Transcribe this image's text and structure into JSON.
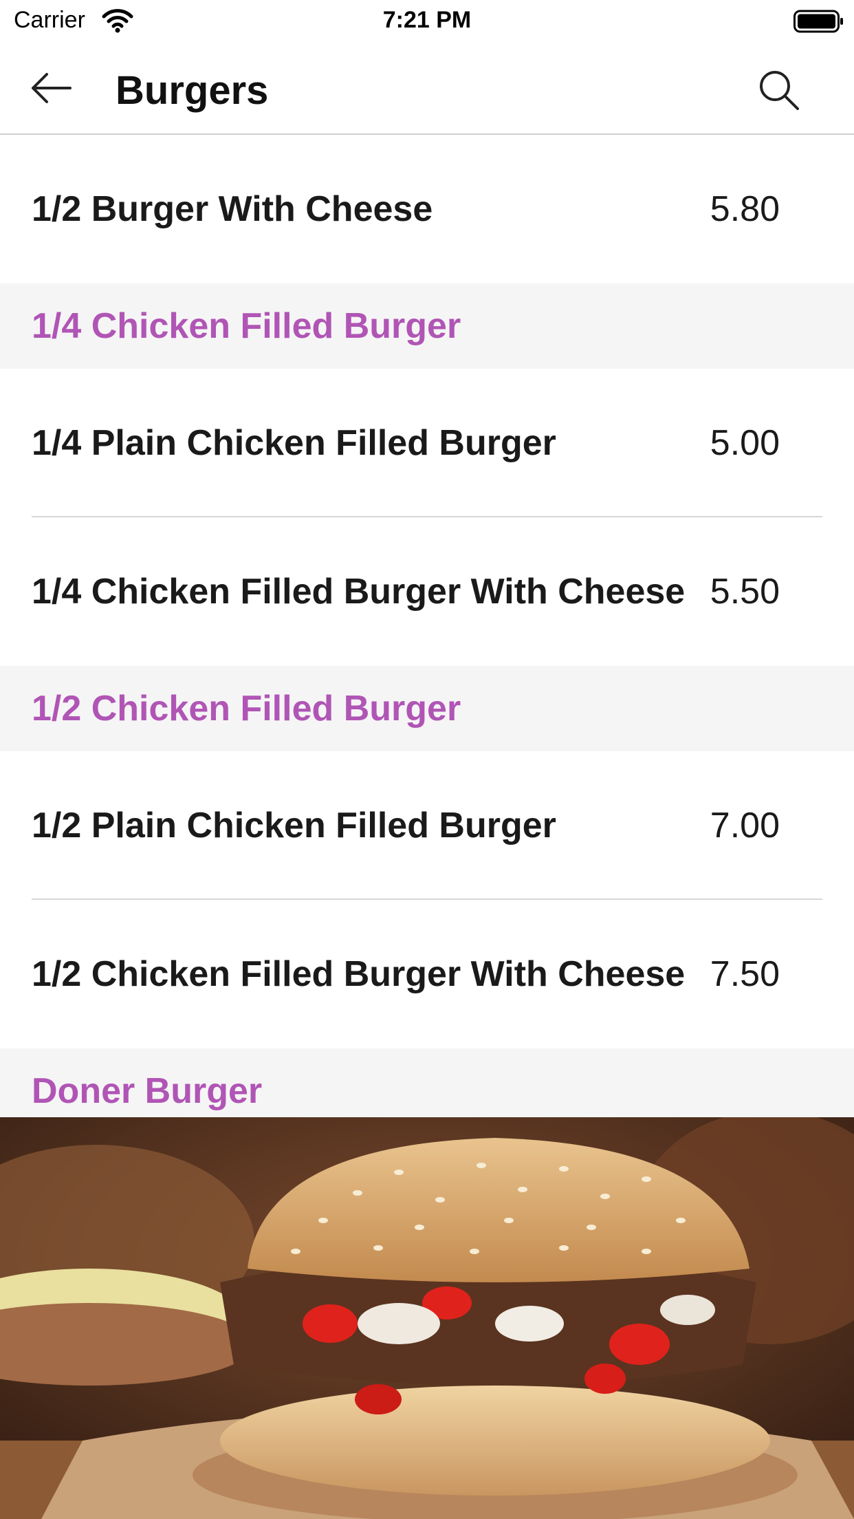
{
  "status_bar": {
    "carrier": "Carrier",
    "time": "7:21 PM"
  },
  "header": {
    "title": "Burgers"
  },
  "menu": {
    "top_item": {
      "name": "1/2 Burger With Cheese",
      "price": "5.80"
    },
    "sections": [
      {
        "title": "1/4 Chicken Filled Burger",
        "items": [
          {
            "name": "1/4 Plain Chicken Filled Burger",
            "price": "5.00"
          },
          {
            "name": "1/4 Chicken Filled Burger With Cheese",
            "price": "5.50"
          }
        ]
      },
      {
        "title": "1/2 Chicken Filled Burger",
        "items": [
          {
            "name": "1/2 Plain Chicken Filled Burger",
            "price": "7.00"
          },
          {
            "name": "1/2 Chicken Filled Burger With Cheese",
            "price": "7.50"
          }
        ]
      },
      {
        "title": "Doner Burger",
        "items": []
      }
    ]
  },
  "colors": {
    "accent": "#b055b5",
    "section_bg": "#f5f5f5",
    "divider": "#d6d6d6"
  },
  "icons": {
    "back": "arrow-left-icon",
    "search": "search-icon",
    "wifi": "wifi-icon",
    "battery": "battery-icon"
  }
}
